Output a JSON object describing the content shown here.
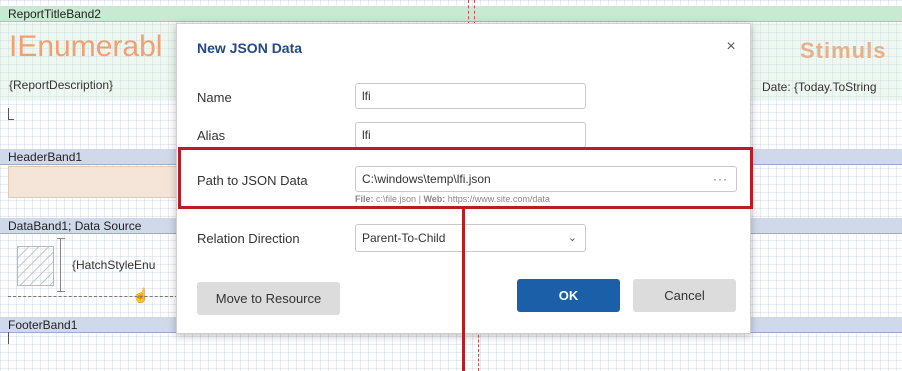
{
  "designer": {
    "title_band": "ReportTitleBand2",
    "report_title": "IEnumerabl",
    "report_description": "{ReportDescription}",
    "date_expression": "Date: {Today.ToString",
    "logo_text": "Stimuls",
    "header_band": "HeaderBand1",
    "data_band": "DataBand1; Data Source",
    "hatch_text": "{HatchStyleEnu",
    "footer_band": "FooterBand1"
  },
  "dialog": {
    "title": "New JSON Data",
    "close_glyph": "×",
    "fields": {
      "name_label": "Name",
      "name_value": "lfi",
      "alias_label": "Alias",
      "alias_value": "lfi",
      "path_label": "Path to JSON Data",
      "path_value": "C:\\windows\\temp\\lfi.json",
      "path_browse": "···",
      "hint_file_label": "File:",
      "hint_file_value": "c:\\file.json",
      "hint_sep": "|",
      "hint_web_label": "Web:",
      "hint_web_value": "https://www.site.com/data",
      "relation_label": "Relation Direction",
      "relation_value": "Parent-To-Child"
    },
    "buttons": {
      "move": "Move to Resource",
      "ok": "OK",
      "cancel": "Cancel"
    }
  },
  "icons": {
    "close": "close-icon",
    "browse": "ellipsis-icon",
    "chevron": "chevron-down-icon",
    "cursor": "hand-cursor-icon"
  },
  "colors": {
    "accent": "#1a5fa8",
    "highlight": "#b91c22",
    "title_text": "#22498a"
  }
}
